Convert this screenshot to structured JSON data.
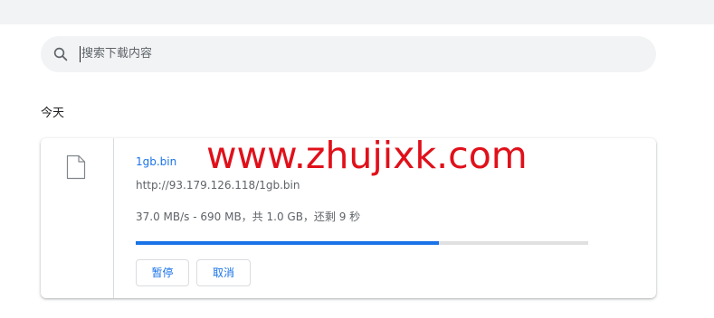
{
  "search": {
    "placeholder": "搜索下载内容",
    "value": ""
  },
  "section": {
    "title": "今天"
  },
  "download": {
    "file_name": "1gb.bin",
    "url": "http://93.179.126.118/1gb.bin",
    "status": "37.0 MB/s - 690 MB，共 1.0 GB，还剩 9 秒",
    "progress_fraction": 0.67,
    "pause_label": "暂停",
    "cancel_label": "取消",
    "icon": "file-icon"
  },
  "watermark": {
    "text": "www.zhujixk.com",
    "color": "#e0101a"
  },
  "colors": {
    "accent": "#1a73e8",
    "search_bg": "#f1f3f4",
    "progress_track": "#e0e0e0",
    "secondary_text": "#5f6368"
  }
}
